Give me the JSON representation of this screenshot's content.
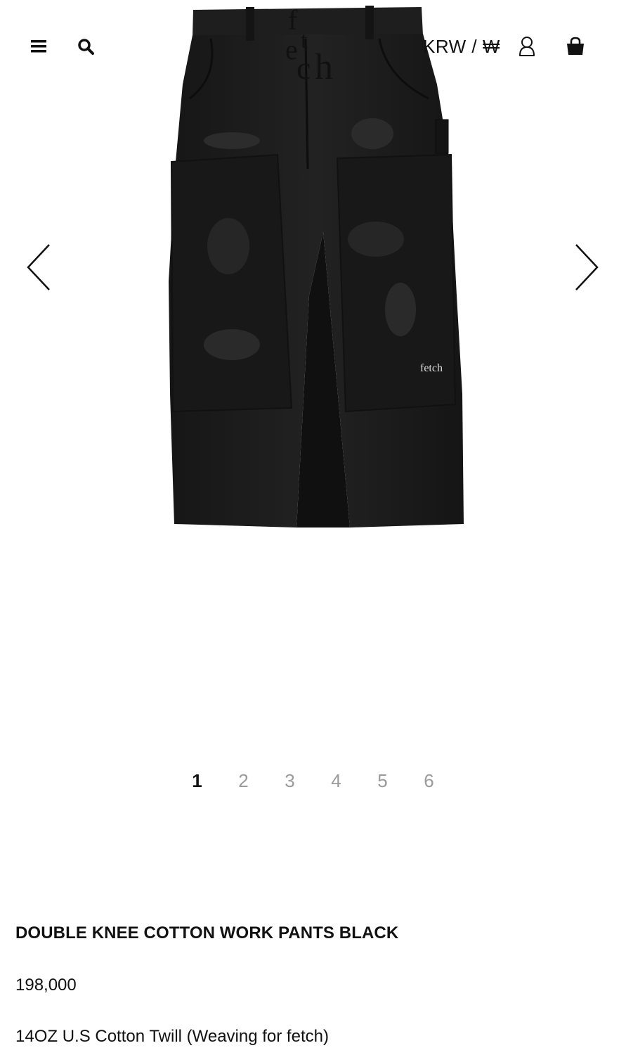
{
  "header": {
    "menu_icon": "hamburger-menu-icon",
    "search_icon": "search-icon",
    "logo_text": "fetch",
    "currency_label": "KRW / ₩",
    "user_icon": "user-icon",
    "cart_icon": "shopping-bag-icon"
  },
  "gallery": {
    "prev_icon": "chevron-left-icon",
    "next_icon": "chevron-right-icon",
    "embroidery_text": "fetch",
    "pages": [
      "1",
      "2",
      "3",
      "4",
      "5",
      "6"
    ],
    "active_page": "1"
  },
  "product": {
    "title": "DOUBLE KNEE COTTON WORK PANTS BLACK",
    "price": "198,000",
    "description": "14OZ U.S Cotton Twill (Weaving for fetch)"
  },
  "colors": {
    "text": "#111111",
    "pager_inactive": "#9a9a9a",
    "pants": "#1c1c1c"
  }
}
